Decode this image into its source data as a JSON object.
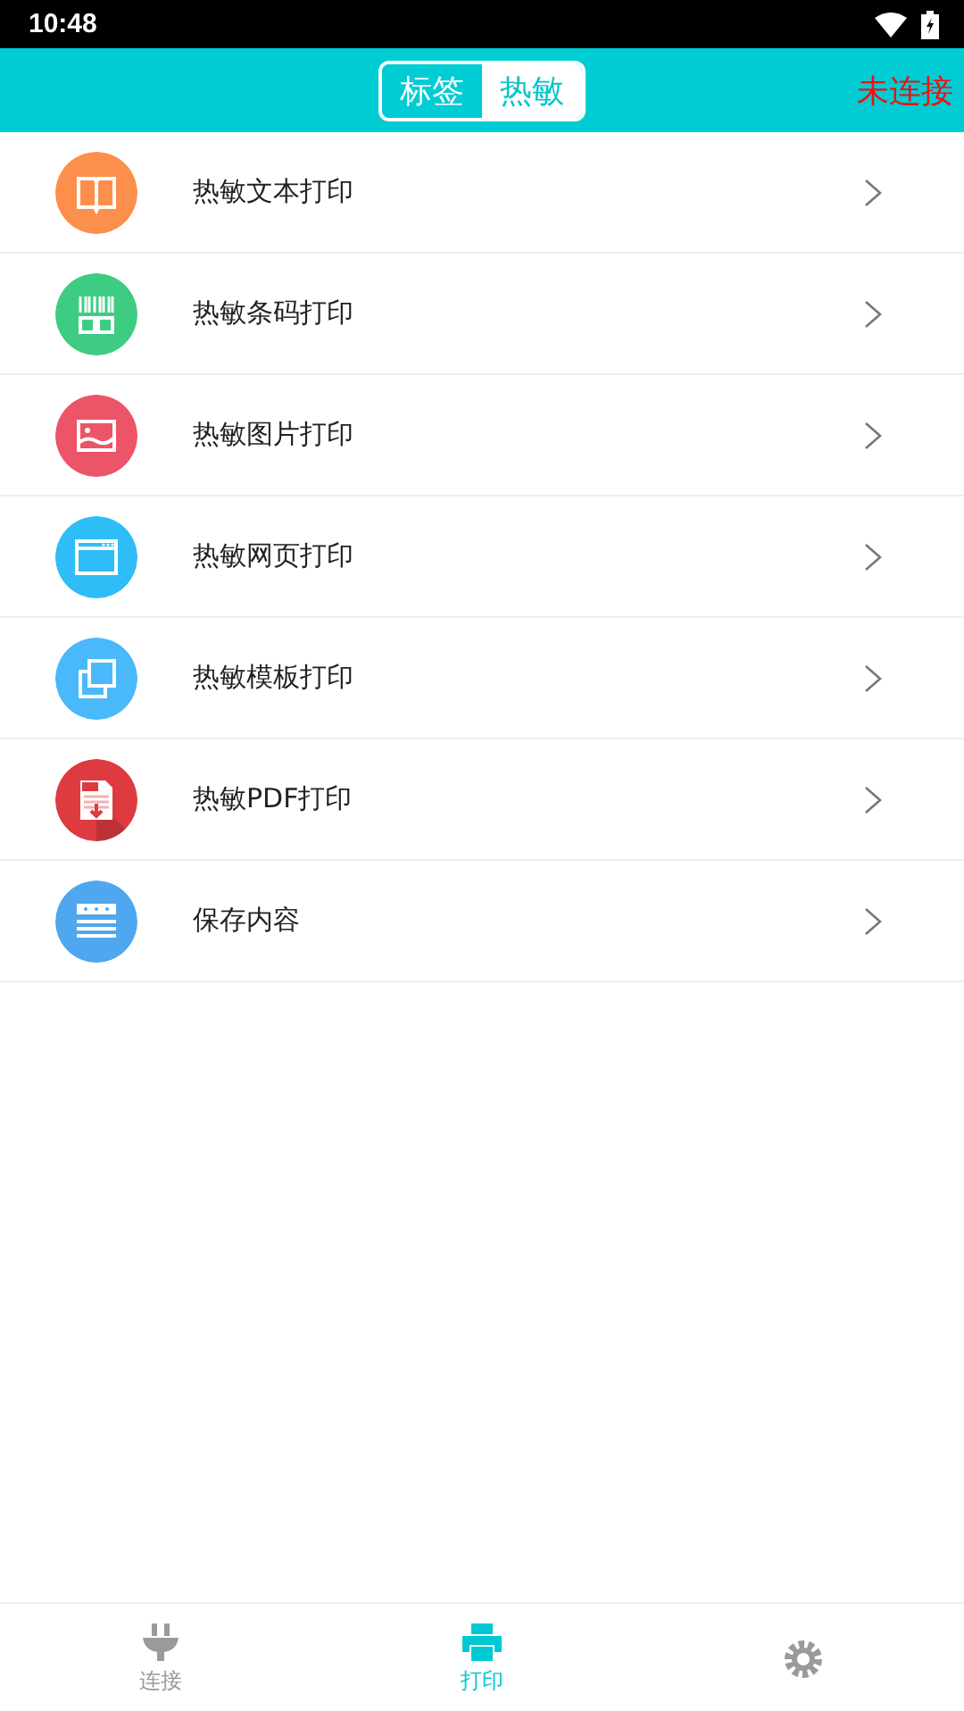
{
  "status_bar": {
    "time": "10:48"
  },
  "header": {
    "segments": [
      {
        "label": "标签",
        "selected": true
      },
      {
        "label": "热敏",
        "selected": false
      }
    ],
    "connection": "未连接"
  },
  "menu": [
    {
      "label": "热敏文本打印",
      "kind": "book",
      "color": "#fd8f4c"
    },
    {
      "label": "热敏条码打印",
      "kind": "barcode",
      "color": "#3ecc82"
    },
    {
      "label": "热敏图片打印",
      "kind": "image",
      "color": "#ec5467"
    },
    {
      "label": "热敏网页打印",
      "kind": "web",
      "color": "#2fbdf7"
    },
    {
      "label": "热敏模板打印",
      "kind": "copy",
      "color": "#4ab9fb"
    },
    {
      "label": "热敏PDF打印",
      "kind": "pdf",
      "color": "#de3b40"
    },
    {
      "label": "保存内容",
      "kind": "list",
      "color": "#4fa7f0"
    }
  ],
  "bottom_nav": [
    {
      "label": "连接",
      "kind": "plug",
      "selected": false
    },
    {
      "label": "打印",
      "kind": "printer",
      "selected": true
    },
    {
      "kind": "gear",
      "selected": false
    }
  ]
}
